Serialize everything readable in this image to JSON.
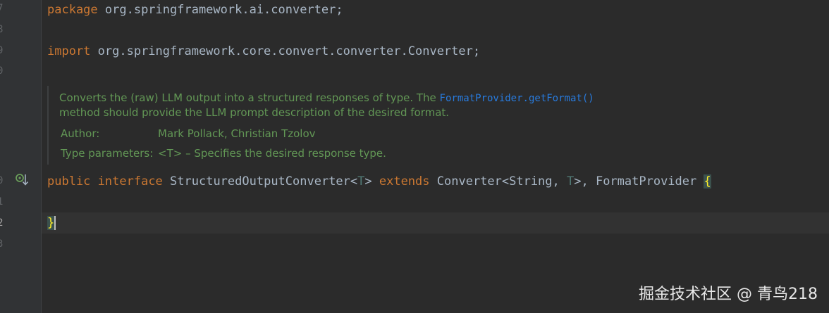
{
  "gutter": {
    "line_numbers": [
      "7",
      "8",
      "9",
      "0",
      "0",
      "1",
      "2",
      "3"
    ]
  },
  "code": {
    "line_package": {
      "kw": "package",
      "rest": " org.springframework.ai.converter;"
    },
    "line_import": {
      "kw": "import",
      "rest": " org.springframework.core.convert.converter.Converter;"
    },
    "line_decl": {
      "public": "public",
      "interface": "interface",
      "name": " StructuredOutputConverter<",
      "T1": "T",
      "gt1": "> ",
      "extends": "extends",
      "conv": " Converter<String, ",
      "T2": "T",
      "tail": ">, FormatProvider ",
      "brace": "{"
    },
    "line_close": {
      "brace": "}"
    }
  },
  "javadoc": {
    "line1": "Converts the (raw) LLM output into a structured responses of type. The ",
    "link": "FormatProvider.getFormat()",
    "line2": "method should provide the LLM prompt description of the desired format.",
    "author_label": "Author:",
    "author_value": "Mark Pollack, Christian Tzolov",
    "type_params_label": "Type parameters:",
    "type_params_value": "<T> – Specifies the desired response type."
  },
  "watermark": {
    "text": "掘金技术社区 @ 青鸟218"
  },
  "colors": {
    "background": "#2b2b2b",
    "keyword": "#cc7832",
    "doc_text": "#629755",
    "doc_link": "#287bde",
    "type_param": "#507874"
  }
}
